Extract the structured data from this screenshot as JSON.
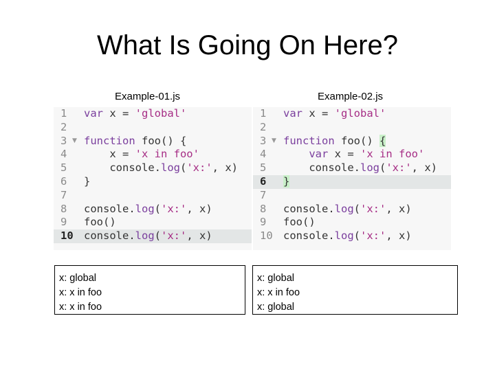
{
  "slide": {
    "title": "What Is Going On Here?"
  },
  "examples": [
    {
      "filename": "Example-01.js",
      "lines": [
        {
          "num": "1",
          "tokens": [
            {
              "t": "var",
              "c": "kw"
            },
            {
              "t": " x = ",
              "c": "pl"
            },
            {
              "t": "'global'",
              "c": "str"
            }
          ]
        },
        {
          "num": "2",
          "tokens": []
        },
        {
          "num": "3",
          "fold": "▼",
          "tokens": [
            {
              "t": "function",
              "c": "kw"
            },
            {
              "t": " foo() {",
              "c": "pl"
            }
          ]
        },
        {
          "num": "4",
          "tokens": [
            {
              "t": "    x = ",
              "c": "pl"
            },
            {
              "t": "'x in foo'",
              "c": "str"
            }
          ]
        },
        {
          "num": "5",
          "tokens": [
            {
              "t": "    console.",
              "c": "pl"
            },
            {
              "t": "log",
              "c": "fn"
            },
            {
              "t": "(",
              "c": "pl"
            },
            {
              "t": "'x:'",
              "c": "str"
            },
            {
              "t": ", x)",
              "c": "pl"
            }
          ]
        },
        {
          "num": "6",
          "tokens": [
            {
              "t": "}",
              "c": "pl"
            }
          ]
        },
        {
          "num": "7",
          "tokens": []
        },
        {
          "num": "8",
          "tokens": [
            {
              "t": "console.",
              "c": "pl"
            },
            {
              "t": "log",
              "c": "fn"
            },
            {
              "t": "(",
              "c": "pl"
            },
            {
              "t": "'x:'",
              "c": "str"
            },
            {
              "t": ", x)",
              "c": "pl"
            }
          ]
        },
        {
          "num": "9",
          "tokens": [
            {
              "t": "foo()",
              "c": "pl"
            }
          ]
        },
        {
          "num": "10",
          "active": true,
          "tokens": [
            {
              "t": "console.",
              "c": "pl"
            },
            {
              "t": "log",
              "c": "fn"
            },
            {
              "t": "(",
              "c": "pl"
            },
            {
              "t": "'x:'",
              "c": "str"
            },
            {
              "t": ", x)",
              "c": "pl"
            }
          ]
        }
      ],
      "output": [
        "x: global",
        "x: x in foo",
        "x: x in foo"
      ]
    },
    {
      "filename": "Example-02.js",
      "lines": [
        {
          "num": "1",
          "tokens": [
            {
              "t": "var",
              "c": "kw"
            },
            {
              "t": " x = ",
              "c": "pl"
            },
            {
              "t": "'global'",
              "c": "str"
            }
          ]
        },
        {
          "num": "2",
          "tokens": []
        },
        {
          "num": "3",
          "fold": "▼",
          "tokens": [
            {
              "t": "function",
              "c": "kw"
            },
            {
              "t": " foo() ",
              "c": "pl"
            },
            {
              "t": "{",
              "c": "pl",
              "match": true
            }
          ]
        },
        {
          "num": "4",
          "tokens": [
            {
              "t": "    ",
              "c": "pl"
            },
            {
              "t": "var",
              "c": "kw"
            },
            {
              "t": " x = ",
              "c": "pl"
            },
            {
              "t": "'x in foo'",
              "c": "str"
            }
          ]
        },
        {
          "num": "5",
          "tokens": [
            {
              "t": "    console.",
              "c": "pl"
            },
            {
              "t": "log",
              "c": "fn"
            },
            {
              "t": "(",
              "c": "pl"
            },
            {
              "t": "'x:'",
              "c": "str"
            },
            {
              "t": ", x)",
              "c": "pl"
            }
          ]
        },
        {
          "num": "6",
          "active": true,
          "tokens": [
            {
              "t": "}",
              "c": "pl",
              "match": true
            }
          ]
        },
        {
          "num": "7",
          "tokens": []
        },
        {
          "num": "8",
          "tokens": [
            {
              "t": "console.",
              "c": "pl"
            },
            {
              "t": "log",
              "c": "fn"
            },
            {
              "t": "(",
              "c": "pl"
            },
            {
              "t": "'x:'",
              "c": "str"
            },
            {
              "t": ", x)",
              "c": "pl"
            }
          ]
        },
        {
          "num": "9",
          "tokens": [
            {
              "t": "foo()",
              "c": "pl"
            }
          ]
        },
        {
          "num": "10",
          "tokens": [
            {
              "t": "console.",
              "c": "pl"
            },
            {
              "t": "log",
              "c": "fn"
            },
            {
              "t": "(",
              "c": "pl"
            },
            {
              "t": "'x:'",
              "c": "str"
            },
            {
              "t": ", x)",
              "c": "pl"
            }
          ]
        }
      ],
      "output": [
        "x: global",
        "x: x in foo",
        "x: global"
      ]
    }
  ]
}
